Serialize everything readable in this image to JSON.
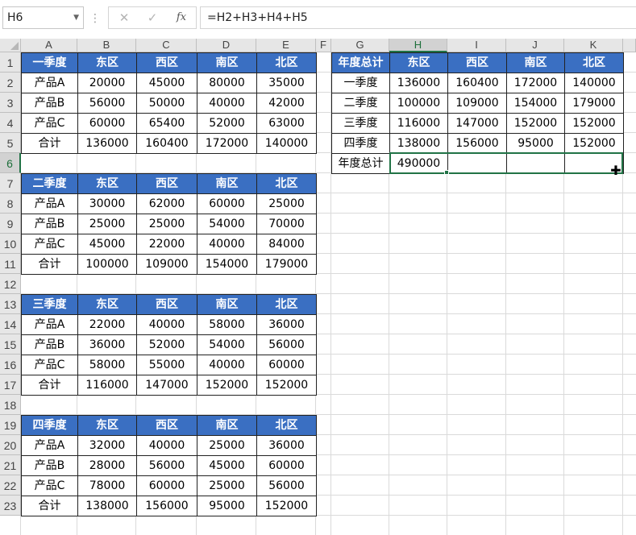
{
  "name_box": "H6",
  "formula": "=H2+H3+H4+H5",
  "formula_buttons": {
    "cancel": "✕",
    "enter": "✓",
    "function": "fx"
  },
  "columns": [
    "A",
    "B",
    "C",
    "D",
    "E",
    "F",
    "G",
    "H",
    "I",
    "J",
    "K"
  ],
  "rows": [
    "1",
    "2",
    "3",
    "4",
    "5",
    "6",
    "7",
    "8",
    "9",
    "10",
    "11",
    "12",
    "13",
    "14",
    "15",
    "16",
    "17",
    "18",
    "19",
    "20",
    "21",
    "22",
    "23"
  ],
  "selected_cell": "H6",
  "quarter_tables": [
    {
      "header": [
        "一季度",
        "东区",
        "西区",
        "南区",
        "北区"
      ],
      "rows": [
        [
          "产品A",
          "20000",
          "45000",
          "80000",
          "35000"
        ],
        [
          "产品B",
          "56000",
          "50000",
          "40000",
          "42000"
        ],
        [
          "产品C",
          "60000",
          "65400",
          "52000",
          "63000"
        ],
        [
          "合计",
          "136000",
          "160400",
          "172000",
          "140000"
        ]
      ]
    },
    {
      "header": [
        "二季度",
        "东区",
        "西区",
        "南区",
        "北区"
      ],
      "rows": [
        [
          "产品A",
          "30000",
          "62000",
          "60000",
          "25000"
        ],
        [
          "产品B",
          "25000",
          "25000",
          "54000",
          "70000"
        ],
        [
          "产品C",
          "45000",
          "22000",
          "40000",
          "84000"
        ],
        [
          "合计",
          "100000",
          "109000",
          "154000",
          "179000"
        ]
      ]
    },
    {
      "header": [
        "三季度",
        "东区",
        "西区",
        "南区",
        "北区"
      ],
      "rows": [
        [
          "产品A",
          "22000",
          "40000",
          "58000",
          "36000"
        ],
        [
          "产品B",
          "36000",
          "52000",
          "54000",
          "56000"
        ],
        [
          "产品C",
          "58000",
          "55000",
          "40000",
          "60000"
        ],
        [
          "合计",
          "116000",
          "147000",
          "152000",
          "152000"
        ]
      ]
    },
    {
      "header": [
        "四季度",
        "东区",
        "西区",
        "南区",
        "北区"
      ],
      "rows": [
        [
          "产品A",
          "32000",
          "40000",
          "25000",
          "36000"
        ],
        [
          "产品B",
          "28000",
          "56000",
          "45000",
          "60000"
        ],
        [
          "产品C",
          "78000",
          "60000",
          "25000",
          "56000"
        ],
        [
          "合计",
          "138000",
          "156000",
          "95000",
          "152000"
        ]
      ]
    }
  ],
  "annual_table": {
    "header": [
      "年度总计",
      "东区",
      "西区",
      "南区",
      "北区"
    ],
    "rows": [
      [
        "一季度",
        "136000",
        "160400",
        "172000",
        "140000"
      ],
      [
        "二季度",
        "100000",
        "109000",
        "154000",
        "179000"
      ],
      [
        "三季度",
        "116000",
        "147000",
        "152000",
        "152000"
      ],
      [
        "四季度",
        "138000",
        "156000",
        "95000",
        "152000"
      ],
      [
        "年度总计",
        "490000",
        "",
        "",
        ""
      ]
    ]
  },
  "colors": {
    "header_fill": "#3a6fc2",
    "header_text": "#ffffff",
    "selection": "#217346"
  }
}
